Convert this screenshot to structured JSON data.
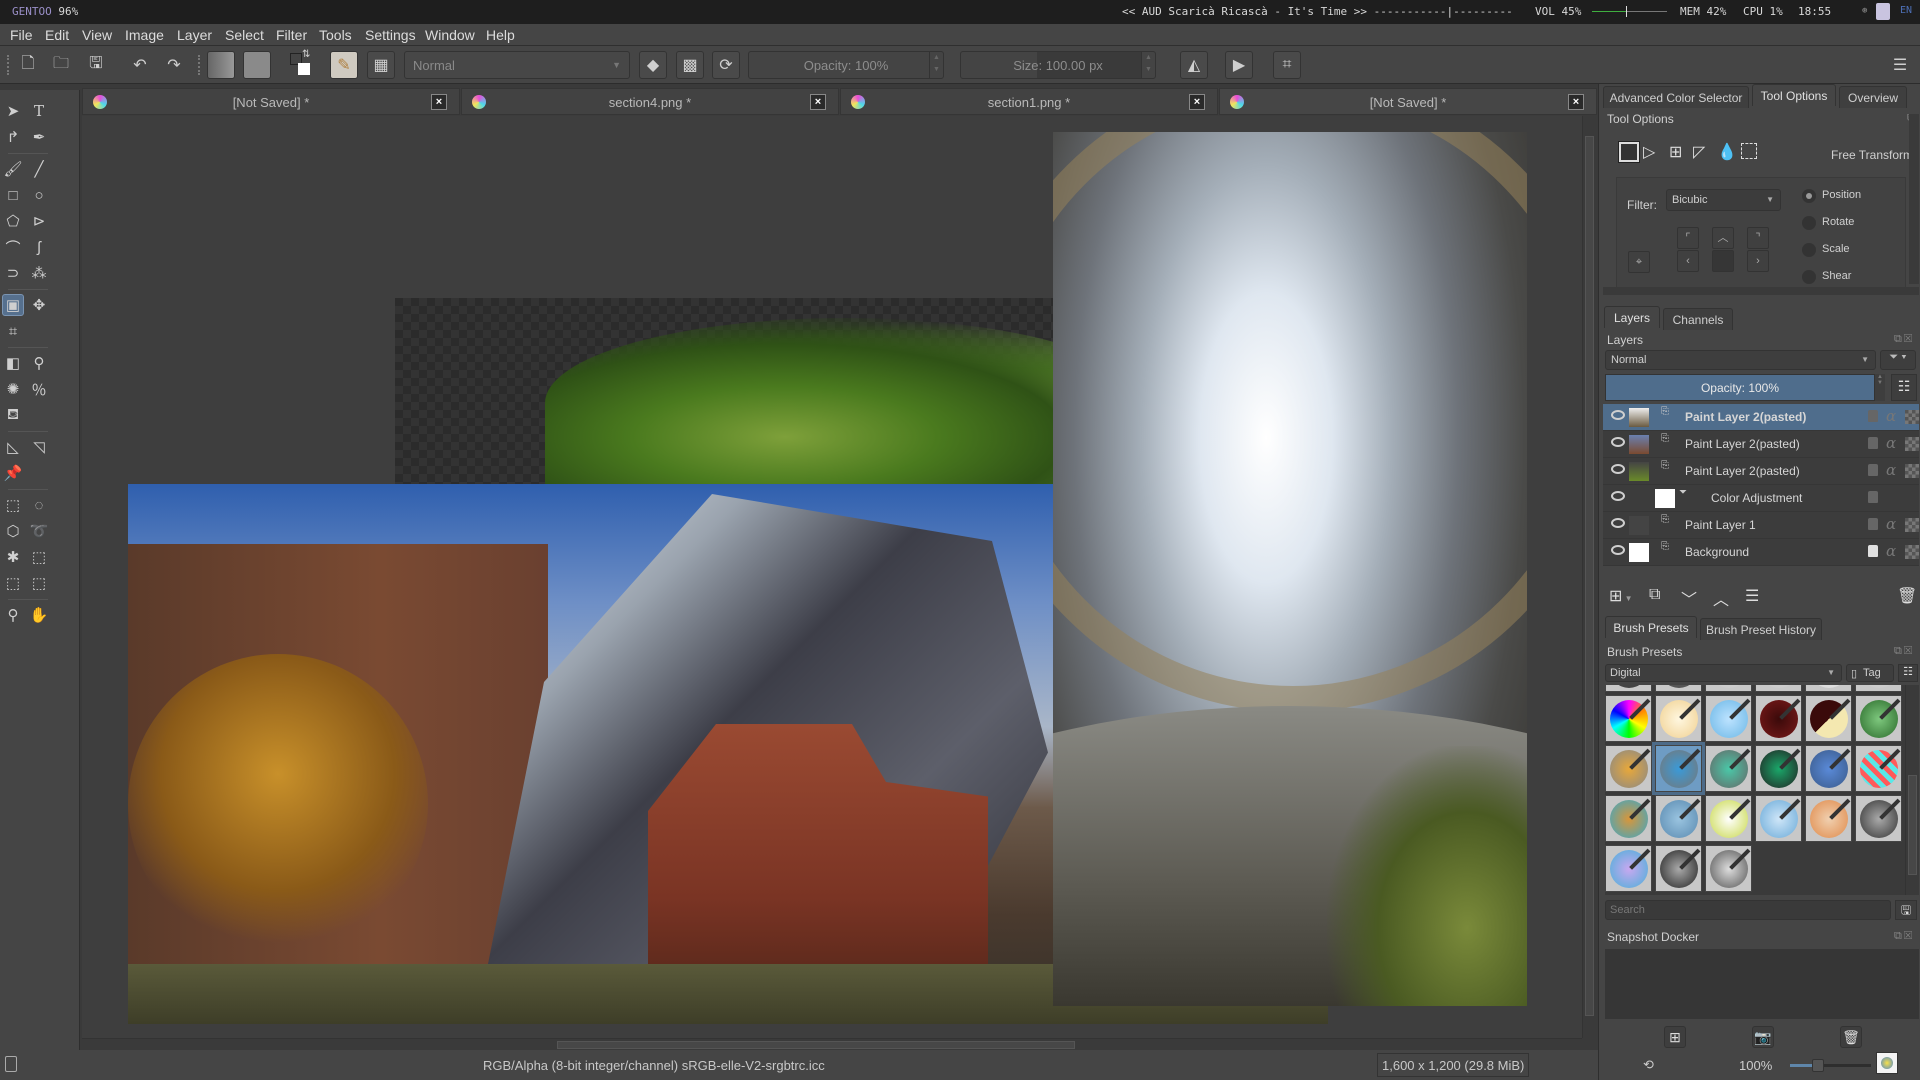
{
  "system_bar": {
    "workspace": "GENTOO",
    "battery": "96%",
    "now_playing": "<< AUD Scaricà Ricascà - It's Time >> -----------|---------",
    "volume_label": "VOL 45%",
    "volume_level": 0.45,
    "mem": "MEM 42%",
    "cpu": "CPU 1%",
    "clock": "18:55",
    "keyboard_layout": "EN"
  },
  "menu": [
    "File",
    "Edit",
    "View",
    "Image",
    "Layer",
    "Select",
    "Filter",
    "Tools",
    "Settings",
    "Window",
    "Help"
  ],
  "toolbar": {
    "blend_mode": "Normal",
    "opacity_label": "Opacity: 100%",
    "size_label": "Size: 100.00 px"
  },
  "tabs": [
    {
      "title": "[Not Saved]  *",
      "close": "×"
    },
    {
      "title": "section4.png *",
      "close": "×"
    },
    {
      "title": "section1.png *",
      "close": "×"
    },
    {
      "title": "[Not Saved]  *",
      "close": "×"
    }
  ],
  "status_bar": {
    "color_space": "RGB/Alpha (8-bit integer/channel)  sRGB-elle-V2-srgbtrc.icc",
    "image_size": "1,600 x 1,200 (29.8 MiB)",
    "zoom": "100%",
    "zoom_level": 0.35
  },
  "dock": {
    "top_tabs": [
      "Advanced Color Selector",
      "Tool Options",
      "Overview"
    ],
    "tool_options": {
      "title": "Tool Options",
      "mode_label": "Free Transform",
      "filter_label": "Filter:",
      "filter_value": "Bicubic",
      "radios": [
        {
          "label": "Position",
          "checked": true
        },
        {
          "label": "Rotate",
          "checked": false
        },
        {
          "label": "Scale",
          "checked": false
        },
        {
          "label": "Shear",
          "checked": false
        }
      ]
    },
    "layers_tabs": [
      "Layers",
      "Channels"
    ],
    "layers": {
      "title": "Layers",
      "blend_mode": "Normal",
      "opacity_label": "Opacity:  100%",
      "items": [
        {
          "name": "Paint Layer 2(pasted)",
          "selected": true,
          "locked": false
        },
        {
          "name": "Paint Layer 2(pasted)",
          "selected": false,
          "locked": false
        },
        {
          "name": "Paint Layer 2(pasted)",
          "selected": false,
          "locked": false
        },
        {
          "name": "Color Adjustment",
          "selected": false,
          "locked": false
        },
        {
          "name": "Paint Layer 1",
          "selected": false,
          "locked": false
        },
        {
          "name": "Background",
          "selected": false,
          "locked": true
        }
      ]
    },
    "brush_tabs": [
      "Brush Presets",
      "Brush Preset History"
    ],
    "brush_presets": {
      "title": "Brush Presets",
      "tag_filter": "Digital",
      "tag_button": "Tag",
      "search_placeholder": "Search",
      "selected_index": 13
    },
    "snapshot": {
      "title": "Snapshot Docker"
    }
  }
}
